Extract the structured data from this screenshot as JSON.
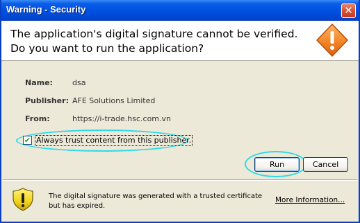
{
  "window": {
    "title": "Warning - Security",
    "close_glyph": "✕"
  },
  "header": {
    "line1": "The application's digital signature cannot be verified.",
    "line2": "Do you want to run the application?",
    "icon": "warning-diamond-icon"
  },
  "details": {
    "name_label": "Name:",
    "name_value": "dsa",
    "publisher_label": "Publisher:",
    "publisher_value": "AFE Solutions Limited",
    "from_label": "From:",
    "from_value": "https://i-trade.hsc.com.vn"
  },
  "trust": {
    "checked": true,
    "check_glyph": "✔",
    "label": "Always trust content from this publisher."
  },
  "buttons": {
    "run": "Run",
    "cancel": "Cancel"
  },
  "footer": {
    "icon": "warning-shield-icon",
    "message": "The digital signature was generated with a trusted certificate but has expired.",
    "more_info": "More Information..."
  },
  "colors": {
    "titlebar": "#0054e3",
    "highlight": "#31d8e6",
    "warning_orange": "#f07b22"
  }
}
